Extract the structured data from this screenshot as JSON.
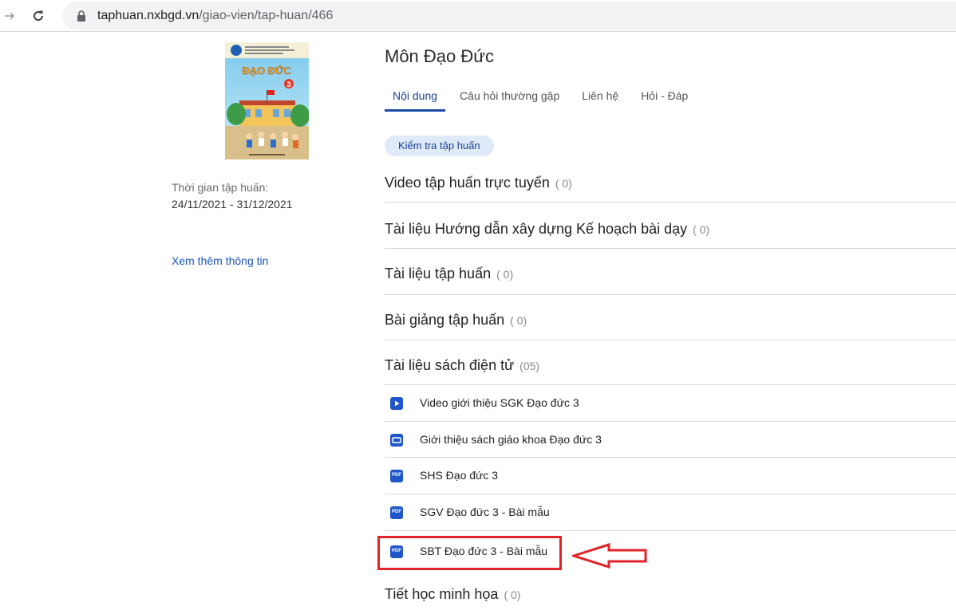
{
  "browser": {
    "url_host": "taphuan.nxbgd.vn",
    "url_path": "/giao-vien/tap-huan/466"
  },
  "sidebar": {
    "cover": {
      "publisher_line": "CHÂN TRỜI SÁNG TẠO",
      "title": "ĐẠO ĐỨC",
      "grade": "3"
    },
    "time_label": "Thời gian tập huấn:",
    "time_value": "24/11/2021 - 31/12/2021",
    "more_link": "Xem thêm thông tin"
  },
  "main": {
    "title": "Môn Đạo Đức",
    "tabs": [
      {
        "label": "Nội dung",
        "active": true
      },
      {
        "label": "Câu hỏi thường gặp",
        "active": false
      },
      {
        "label": "Liên hệ",
        "active": false
      },
      {
        "label": "Hỏi - Đáp",
        "active": false
      }
    ],
    "check_button": "Kiểm tra tập huấn",
    "sections": [
      {
        "title": "Video tập huấn trực tuyến",
        "count": "( 0)"
      },
      {
        "title": "Tài liệu Hướng dẫn xây dựng Kế hoạch bài dạy",
        "count": "( 0)"
      },
      {
        "title": "Tài liệu tập huấn",
        "count": "( 0)"
      },
      {
        "title": "Bài giảng tập huấn",
        "count": "( 0)"
      },
      {
        "title": "Tài liệu sách điện tử",
        "count": "(05)"
      },
      {
        "title": "Tiết học minh họa",
        "count": "( 0)"
      }
    ],
    "documents": [
      {
        "label": "Video giới thiệu SGK Đạo đức 3",
        "icon": "video-play-icon"
      },
      {
        "label": "Giới thiệu sách giáo khoa Đạo đức 3",
        "icon": "slides-icon"
      },
      {
        "label": "SHS Đạo đức 3",
        "icon": "pdf-icon"
      },
      {
        "label": "SGV Đạo đức 3 - Bài mẫu",
        "icon": "pdf-icon"
      },
      {
        "label": "SBT Đạo đức 3 - Bài mẫu",
        "icon": "pdf-icon"
      }
    ],
    "pdf_badge": "PDF"
  },
  "colors": {
    "accent": "#1b4aa8",
    "highlight": "#e0242a",
    "chip_bg": "#dfeaf9"
  }
}
